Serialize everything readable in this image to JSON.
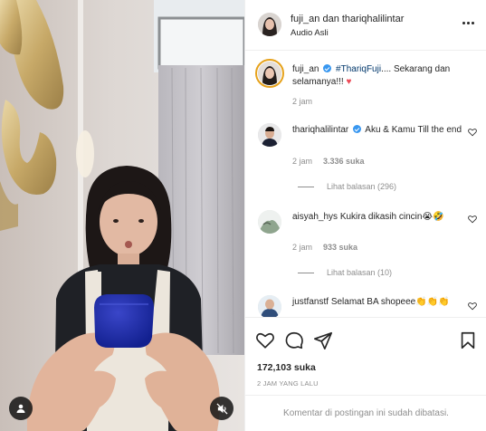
{
  "header": {
    "username": "fuji_an dan thariqhalilintar",
    "audio": "Audio Asli"
  },
  "caption": {
    "username": "fuji_an",
    "hashtag": "#ThariqFuji",
    "text": ".... Sekarang dan selamanya!!! ♥",
    "time": "2 jam"
  },
  "comments": [
    {
      "username": "thariqhalilintar",
      "verified": true,
      "text": "Aku & Kamu Till the end",
      "time": "2 jam",
      "likes": "3.336 suka",
      "replies": "Lihat balasan (296)"
    },
    {
      "username": "aisyah_hys",
      "verified": false,
      "text": "Kukira dikasih cincin😭🤣",
      "time": "2 jam",
      "likes": "933 suka",
      "replies": "Lihat balasan (10)"
    },
    {
      "username": "justfanstf",
      "verified": false,
      "text": "Selamat BA shopeee👏👏👏"
    }
  ],
  "post": {
    "likes": "172,103 suka",
    "timestamp": "2 JAM YANG LALU",
    "comments_disabled": "Komentar di postingan ini sudah dibatasi."
  },
  "icons": {
    "like": "heart-icon",
    "comment": "comment-icon",
    "share": "paper-plane-icon",
    "save": "bookmark-icon",
    "more": "more-options-icon",
    "mute": "muted-speaker-icon",
    "tagged": "user-tag-icon"
  },
  "colors": {
    "verified": "#3897f0",
    "caption_heart": "#ed4956",
    "story_ring": "#e6a21b",
    "muted_text": "#8e8e8e"
  }
}
